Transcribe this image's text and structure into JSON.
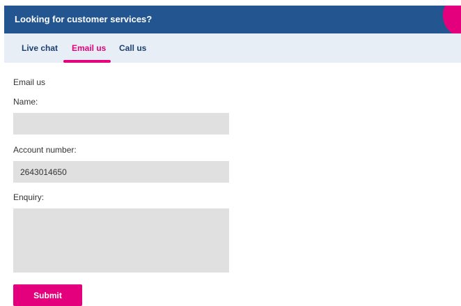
{
  "header": {
    "title": "Looking for customer services?"
  },
  "tabs": [
    {
      "label": "Live chat",
      "active": false
    },
    {
      "label": "Email us",
      "active": true
    },
    {
      "label": "Call us",
      "active": false
    }
  ],
  "form": {
    "heading": "Email us",
    "name_label": "Name:",
    "name_value": "",
    "account_label": "Account number:",
    "account_value": "2643014650",
    "enquiry_label": "Enquiry:",
    "enquiry_value": "",
    "submit_label": "Submit"
  },
  "colors": {
    "header_bg": "#235690",
    "accent": "#e4007c",
    "tab_strip_bg": "#e8eef5",
    "field_bg": "#e0e0e0"
  }
}
